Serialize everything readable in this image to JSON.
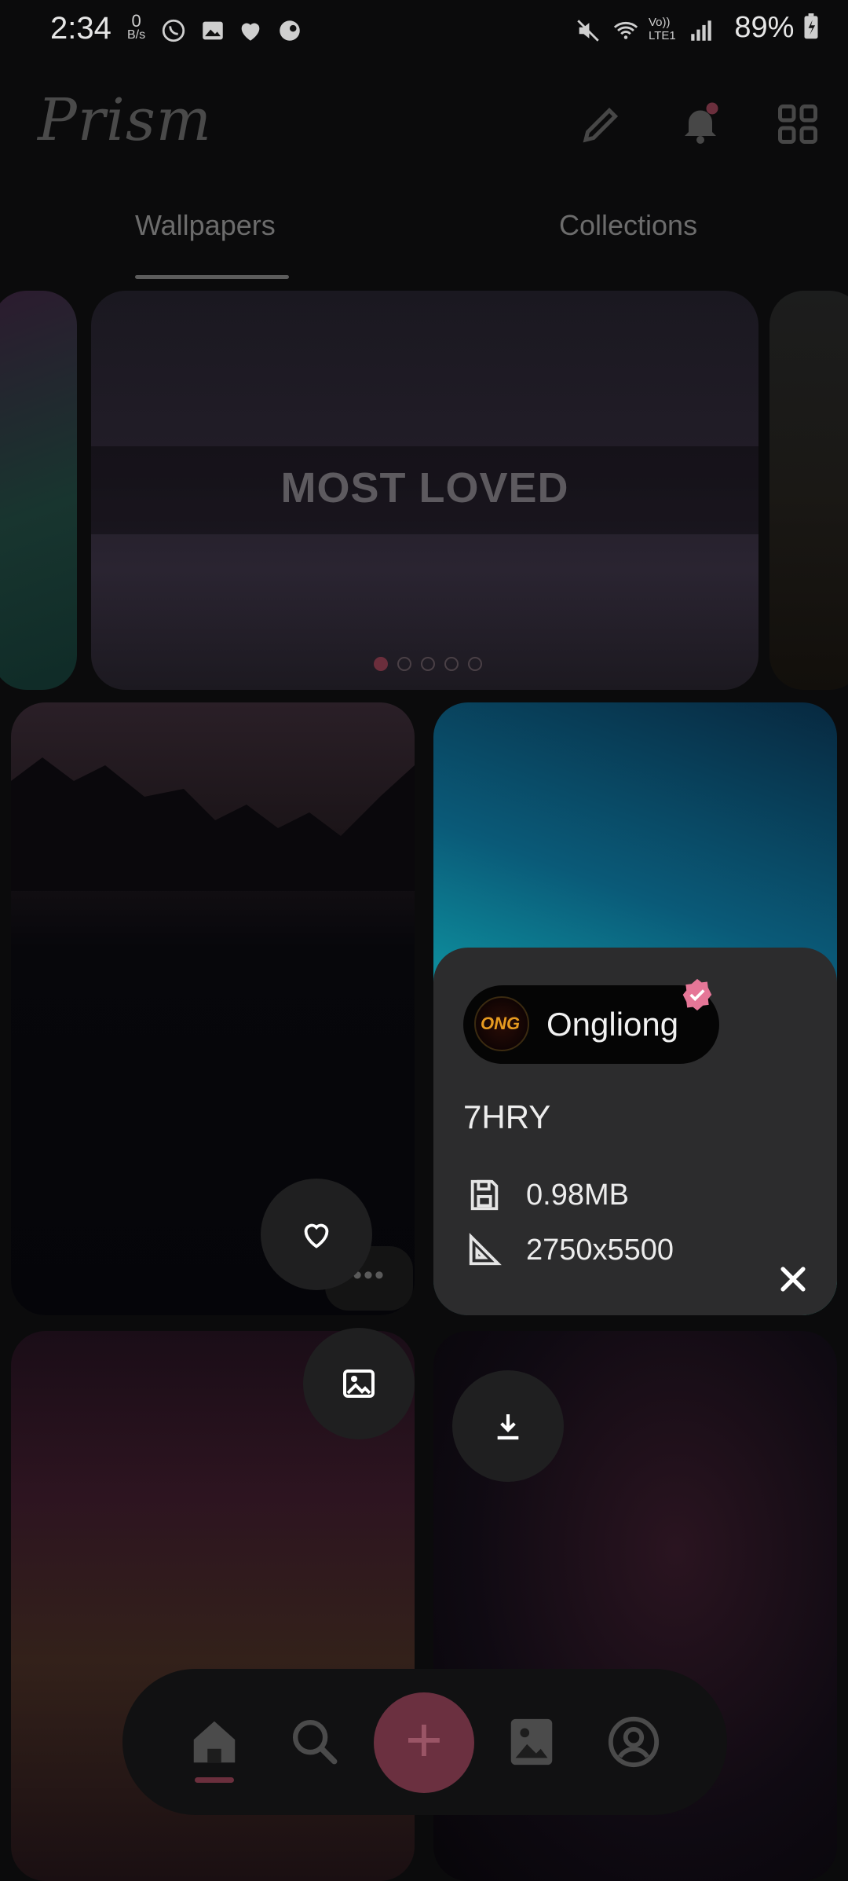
{
  "status_bar": {
    "time": "2:34",
    "net_speed_value": "0",
    "net_speed_unit": "B/s",
    "signal_label": "Vo)) LTE1",
    "battery": "89%"
  },
  "app_bar": {
    "title": "Prism"
  },
  "tabs": [
    {
      "label": "Wallpapers",
      "active": true
    },
    {
      "label": "Collections",
      "active": false
    }
  ],
  "carousel": {
    "banner_title": "MOST LOVED",
    "pages": 5,
    "active_page": 1
  },
  "wallpaper_info": {
    "author": "Ongliong",
    "author_avatar_text": "ONG",
    "verified": true,
    "name": "7HRY",
    "size": "0.98MB",
    "resolution": "2750x5500"
  },
  "more_label": "•••",
  "nav": {
    "items": [
      "home-icon",
      "search-icon",
      "add-icon",
      "wallpaper-icon",
      "profile-icon"
    ],
    "active": "home-icon",
    "add_label": "+"
  },
  "colors": {
    "accent": "#e57697",
    "background": "#0b0b0c",
    "card": "#2c2c2d"
  }
}
